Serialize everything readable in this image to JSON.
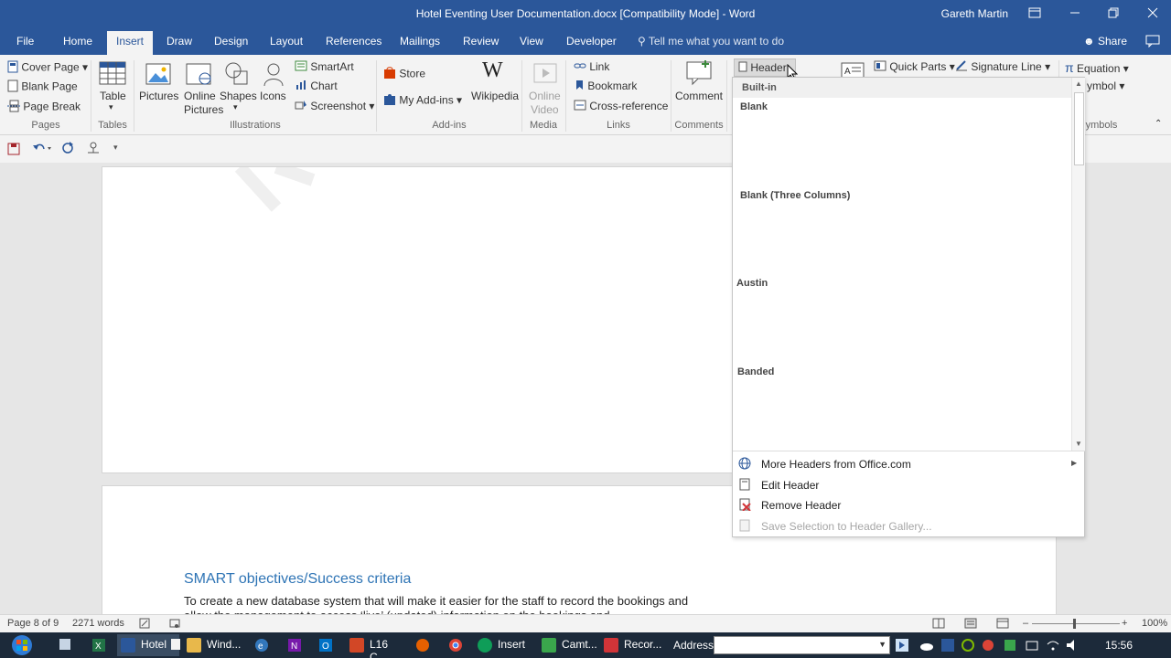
{
  "window": {
    "title": "Hotel Eventing User Documentation.docx [Compatibility Mode] - Word",
    "user": "Gareth Martin"
  },
  "tabs": {
    "file": "File",
    "home": "Home",
    "insert": "Insert",
    "draw": "Draw",
    "design": "Design",
    "layout": "Layout",
    "references": "References",
    "mailings": "Mailings",
    "review": "Review",
    "view": "View",
    "developer": "Developer",
    "tell_me": "Tell me what you want to do",
    "share": "Share"
  },
  "ribbon": {
    "pages": {
      "cover_page": "Cover Page",
      "blank_page": "Blank Page",
      "page_break": "Page Break",
      "group": "Pages"
    },
    "tables": {
      "table": "Table",
      "group": "Tables"
    },
    "illustrations": {
      "pictures": "Pictures",
      "online_pictures_1": "Online",
      "online_pictures_2": "Pictures",
      "shapes": "Shapes",
      "icons": "Icons",
      "smartart": "SmartArt",
      "chart": "Chart",
      "screenshot": "Screenshot",
      "group": "Illustrations"
    },
    "addins": {
      "store": "Store",
      "my_addins": "My Add-ins",
      "wikipedia": "Wikipedia",
      "group": "Add-ins"
    },
    "media": {
      "online_video_1": "Online",
      "online_video_2": "Video",
      "group": "Media"
    },
    "links": {
      "link": "Link",
      "bookmark": "Bookmark",
      "cross_reference": "Cross-reference",
      "group": "Links"
    },
    "comments": {
      "comment": "Comment",
      "group": "Comments"
    },
    "header": "Header",
    "quick_parts": "Quick Parts",
    "signature_line": "Signature Line",
    "equation": "Equation",
    "symbol": "ymbol",
    "symbols_group": "ymbols"
  },
  "dropdown": {
    "category": "Built-in",
    "items": [
      "Blank",
      "Blank (Three Columns)",
      "Austin",
      "Banded"
    ],
    "commands": {
      "more": "More Headers from Office.com",
      "edit": "Edit Header",
      "remove": "Remove Header",
      "save": "Save Selection to Header Gallery..."
    }
  },
  "document": {
    "heading": "SMART objectives/Success criteria",
    "body": "To create a new database system that will make it easier for the staff to record the bookings and allow the management to access ‘live’ (updated) information on the bookings and"
  },
  "status": {
    "page": "Page 8 of 9",
    "words": "2271 words",
    "zoom": "100%"
  },
  "taskbar": {
    "word": "Hotel ...",
    "explorer": "Wind...",
    "ppt": "L16 C...",
    "chrome": "Insert ...",
    "camtasia": "Camt...",
    "recorder": "Recor...",
    "address": "Address",
    "time": "15:56"
  },
  "colors": {
    "word_blue": "#2b579a",
    "taskbar": "#1c2a3a"
  }
}
